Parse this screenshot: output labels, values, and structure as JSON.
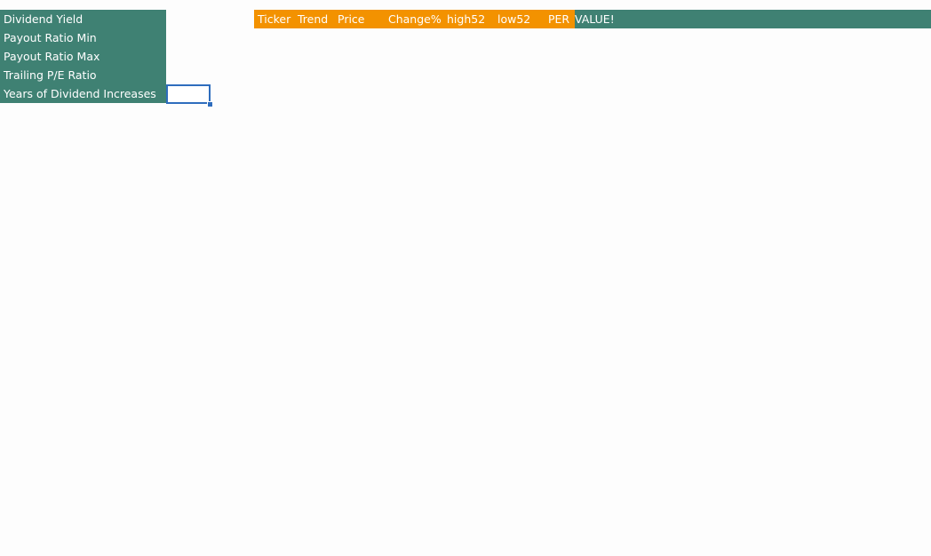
{
  "criteria": {
    "labels": [
      "Dividend Yield",
      "Payout Ratio Min",
      "Payout Ratio Max",
      "Trailing P/E Ratio",
      "Years of Dividend Increases"
    ]
  },
  "header": {
    "columns": [
      "Ticker",
      "Trend",
      "Price",
      "Change%",
      "high52",
      "low52",
      "PER"
    ],
    "error_text": "VALUE!"
  },
  "colors": {
    "criteria_fill": "#3f8173",
    "header_accent": "#f39200",
    "selection_border": "#2e6dbd"
  }
}
